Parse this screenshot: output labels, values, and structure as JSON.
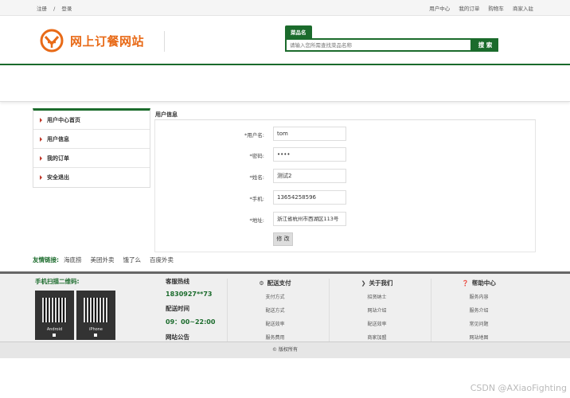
{
  "topbar": {
    "register": "注册",
    "separator": "/",
    "login": "登录",
    "user_center": "用户中心",
    "my_orders": "我的订单",
    "cart": "购物车",
    "merchant_entry": "商家入驻"
  },
  "header": {
    "site_title": "网上订餐网站",
    "search_tab": "菜品名",
    "search_placeholder": "请输入您所需查找菜品名称",
    "search_button": "搜 索"
  },
  "sidebar": {
    "items": [
      {
        "label": "用户中心首页"
      },
      {
        "label": "用户信息"
      },
      {
        "label": "我的订单"
      },
      {
        "label": "安全退出"
      }
    ]
  },
  "panel": {
    "title": "用户信息",
    "fields": {
      "username_label": "*用户名:",
      "username_value": "tom",
      "password_label": "*密码:",
      "password_value": "••••",
      "name_label": "*姓名:",
      "name_value": "测试2",
      "phone_label": "*手机:",
      "phone_value": "13654258596",
      "address_label": "*地址:",
      "address_value": "浙江省杭州市西湖区113号"
    },
    "submit": "修 改"
  },
  "friend_links": {
    "title": "友情链接:",
    "items": [
      "海底捞",
      "美团外卖",
      "饿了么",
      "百度外卖"
    ]
  },
  "footer": {
    "qr_title": "手机扫描二维码:",
    "qr_android": "Android",
    "qr_iphone": "iPhone",
    "hotline_title": "客服热线",
    "hotline_value": "1830927**73",
    "delivery_time_title": "配送时间",
    "delivery_time_value": "09：00~22:00",
    "notice_title": "网站公告",
    "columns": [
      {
        "title": "配送支付",
        "items": [
          "支付方式",
          "配送方式",
          "配送效率",
          "服务费用"
        ]
      },
      {
        "title": "关于我们",
        "items": [
          "招贤纳士",
          "网站介绍",
          "配送效率",
          "商家加盟"
        ]
      },
      {
        "title": "帮助中心",
        "items": [
          "服务内容",
          "服务介绍",
          "常见问题",
          "网站地图"
        ]
      }
    ],
    "copyright": "© 版权所有"
  },
  "watermark": "CSDN @AXiaoFighting",
  "colors": {
    "primary": "#1b6b2c",
    "logo": "#e86a17",
    "accent": "#c0392b"
  }
}
